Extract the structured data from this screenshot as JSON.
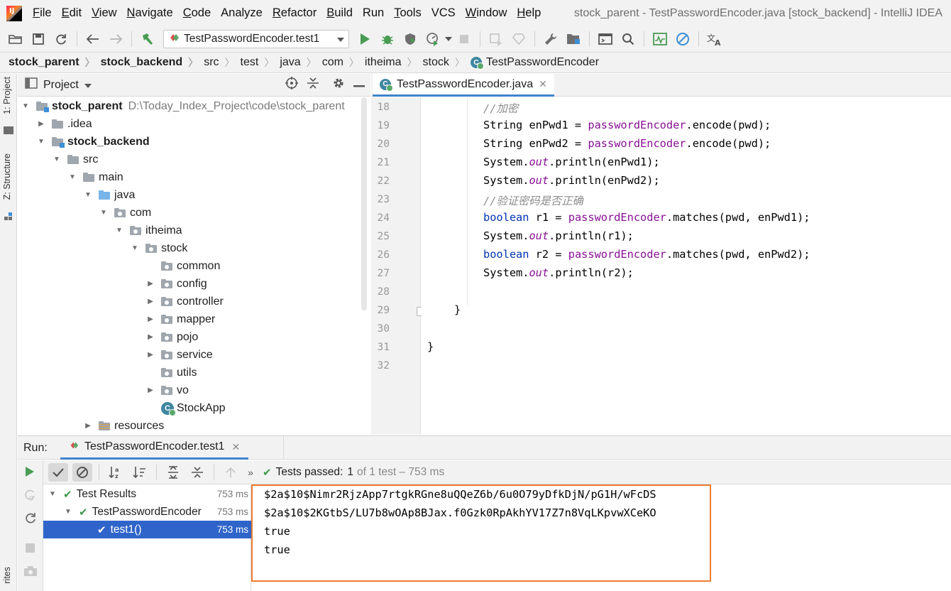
{
  "window": {
    "title": "stock_parent - TestPasswordEncoder.java [stock_backend] - IntelliJ IDEA"
  },
  "menu": [
    {
      "mnemonic": "F",
      "rest": "ile"
    },
    {
      "mnemonic": "E",
      "rest": "dit"
    },
    {
      "mnemonic": "V",
      "rest": "iew"
    },
    {
      "mnemonic": "N",
      "rest": "avigate"
    },
    {
      "mnemonic": "C",
      "rest": "ode"
    },
    {
      "mnemonic": "",
      "rest": "Analyze"
    },
    {
      "mnemonic": "R",
      "rest": "efactor"
    },
    {
      "mnemonic": "B",
      "rest": "uild"
    },
    {
      "mnemonic": "",
      "rest": "Run"
    },
    {
      "mnemonic": "T",
      "rest": "ools"
    },
    {
      "mnemonic": "",
      "rest": "VCS"
    },
    {
      "mnemonic": "W",
      "rest": "indow"
    },
    {
      "mnemonic": "H",
      "rest": "elp"
    }
  ],
  "toolbar": {
    "run_config": "TestPasswordEncoder.test1"
  },
  "breadcrumb": [
    "stock_parent",
    "stock_backend",
    "src",
    "test",
    "java",
    "com",
    "itheima",
    "stock",
    "TestPasswordEncoder"
  ],
  "left_strip": {
    "project_tab": "1: Project",
    "structure_tab": "Z: Structure",
    "favorites_tab": "rites"
  },
  "project_panel": {
    "title": "Project",
    "tree": [
      {
        "label": "stock_parent",
        "hint": "D:\\Today_Index_Project\\code\\stock_parent"
      },
      {
        "label": ".idea"
      },
      {
        "label": "stock_backend"
      },
      {
        "label": "src"
      },
      {
        "label": "main"
      },
      {
        "label": "java"
      },
      {
        "label": "com"
      },
      {
        "label": "itheima"
      },
      {
        "label": "stock"
      },
      {
        "label": "common"
      },
      {
        "label": "config"
      },
      {
        "label": "controller"
      },
      {
        "label": "mapper"
      },
      {
        "label": "pojo"
      },
      {
        "label": "service"
      },
      {
        "label": "utils"
      },
      {
        "label": "vo"
      },
      {
        "label": "StockApp"
      },
      {
        "label": "resources"
      }
    ]
  },
  "editor": {
    "tab_label": "TestPasswordEncoder.java",
    "line_numbers": [
      "18",
      "19",
      "20",
      "21",
      "22",
      "23",
      "24",
      "25",
      "26",
      "27",
      "28",
      "29",
      "30",
      "31",
      "32"
    ],
    "lines": {
      "l18": "//加密",
      "l19_a": "String enPwd1 = ",
      "l19_f": "passwordEncoder",
      "l19_b": ".encode(pwd);",
      "l20_a": "String enPwd2 = ",
      "l20_f": "passwordEncoder",
      "l20_b": ".encode(pwd);",
      "l21_a": "System.",
      "l21_s": "out",
      "l21_b": ".println(enPwd1);",
      "l22_a": "System.",
      "l22_s": "out",
      "l22_b": ".println(enPwd2);",
      "l23": "//验证密码是否正确",
      "l24_k": "boolean",
      "l24_a": " r1 = ",
      "l24_f": "passwordEncoder",
      "l24_b": ".matches(pwd, enPwd1);",
      "l25_a": "System.",
      "l25_s": "out",
      "l25_b": ".println(r1);",
      "l26_k": "boolean",
      "l26_a": " r2 = ",
      "l26_f": "passwordEncoder",
      "l26_b": ".matches(pwd, enPwd2);",
      "l27_a": "System.",
      "l27_s": "out",
      "l27_b": ".println(r2);",
      "l29": "}",
      "l31": "}"
    }
  },
  "run_panel": {
    "label": "Run:",
    "tab_label": "TestPasswordEncoder.test1",
    "status_prefix": "Tests passed:",
    "status_count": "1",
    "status_suffix": "of 1 test – 753 ms",
    "results": [
      {
        "label": "Test Results",
        "time": "753 ms"
      },
      {
        "label": "TestPasswordEncoder",
        "time": "753 ms"
      },
      {
        "label": "test1()",
        "time": "753 ms"
      }
    ],
    "console": [
      "$2a$10$Nimr2RjzApp7rtgkRGne8uQQeZ6b/6u0O79yDfkDjN/pG1H/wFcDS",
      "$2a$10$2KGtbS/LU7b8wOAp8BJax.f0Gzk0RpAkhYV17Z7n8VqLKpvwXCeKO",
      "true",
      "true"
    ]
  },
  "colors": {
    "accent": "#4083c9",
    "selection": "#2f65ca",
    "pass_green": "#3e9a4a",
    "highlight_box": "#ed7d31",
    "keyword": "#0033b3",
    "field": "#871094",
    "comment": "#8c8c8c"
  }
}
